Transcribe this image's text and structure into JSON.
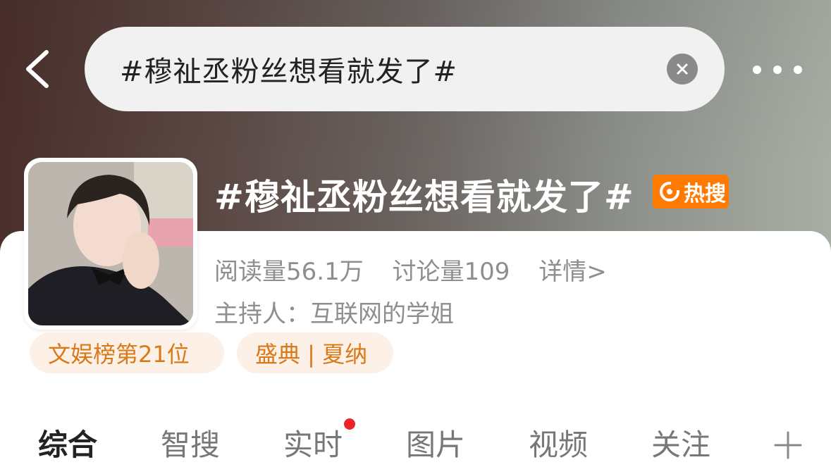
{
  "header": {
    "search_text": "#穆祉丞粉丝想看就发了#"
  },
  "topic": {
    "title": "#穆祉丞粉丝想看就发了#",
    "badge": "热搜",
    "reads": "阅读量56.1万",
    "discussions": "讨论量109",
    "details_link": "详情>",
    "host": "主持人：互联网的学姐"
  },
  "tags": [
    {
      "label": "文娱榜第21位"
    },
    {
      "label": "盛典 | 夏纳"
    }
  ],
  "tabs": [
    {
      "label": "综合",
      "active": true
    },
    {
      "label": "智搜"
    },
    {
      "label": "实时",
      "dot": true
    },
    {
      "label": "图片"
    },
    {
      "label": "视频"
    },
    {
      "label": "关注"
    }
  ],
  "colors": {
    "badge": "#ff7a00",
    "tag_bg": "#fdf0e6",
    "tag_text": "#d97a1a",
    "notify_dot": "#e8262a"
  },
  "icons": {
    "back": "chevron-left-icon",
    "clear": "close-icon",
    "more": "more-horizontal-icon",
    "add": "plus-icon"
  }
}
